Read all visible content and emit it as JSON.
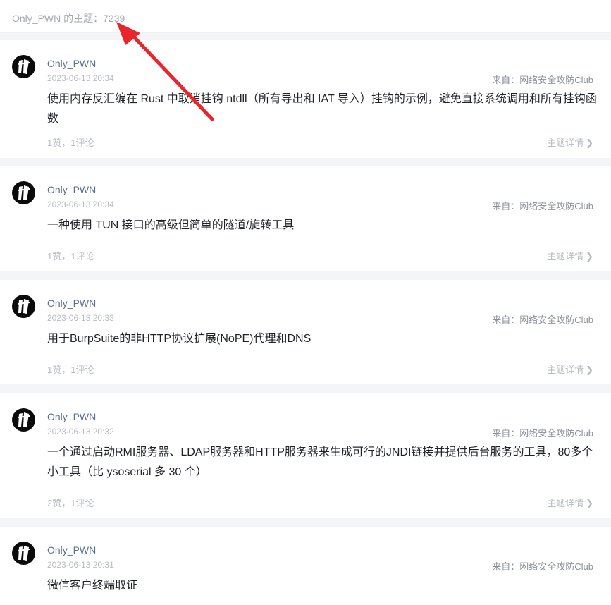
{
  "header": {
    "label": "Only_PWN 的主题：",
    "count": "7239"
  },
  "posts": [
    {
      "author": "Only_PWN",
      "time": "2023-06-13 20:34",
      "source": "来自：网络安全攻防Club",
      "title": "使用内存反汇编在 Rust 中取消挂钩 ntdll（所有导出和 IAT 导入）挂钩的示例，避免直接系统调用和所有挂钩函数",
      "stats": "1赞，1评论",
      "detail": "主题详情"
    },
    {
      "author": "Only_PWN",
      "time": "2023-06-13 20:34",
      "source": "来自：网络安全攻防Club",
      "title": "一种使用 TUN 接口的高级但简单的隧道/旋转工具",
      "stats": "1赞，1评论",
      "detail": "主题详情"
    },
    {
      "author": "Only_PWN",
      "time": "2023-06-13 20:33",
      "source": "来自：网络安全攻防Club",
      "title": "用于BurpSuite的非HTTP协议扩展(NoPE)代理和DNS",
      "stats": "1赞，1评论",
      "detail": "主题详情"
    },
    {
      "author": "Only_PWN",
      "time": "2023-06-13 20:32",
      "source": "来自：网络安全攻防Club",
      "title": "一个通过启动RMI服务器、LDAP服务器和HTTP服务器来生成可行的JNDI链接并提供后台服务的工具，80多个小工具（比 ysoserial 多 30 个）",
      "stats": "2赞，1评论",
      "detail": "主题详情"
    },
    {
      "author": "Only_PWN",
      "time": "2023-06-13 20:31",
      "source": "来自：网络安全攻防Club",
      "title": "微信客户终端取证"
    }
  ],
  "colors": {
    "annotation_arrow": "#e8262b",
    "author_link": "#59708f"
  }
}
